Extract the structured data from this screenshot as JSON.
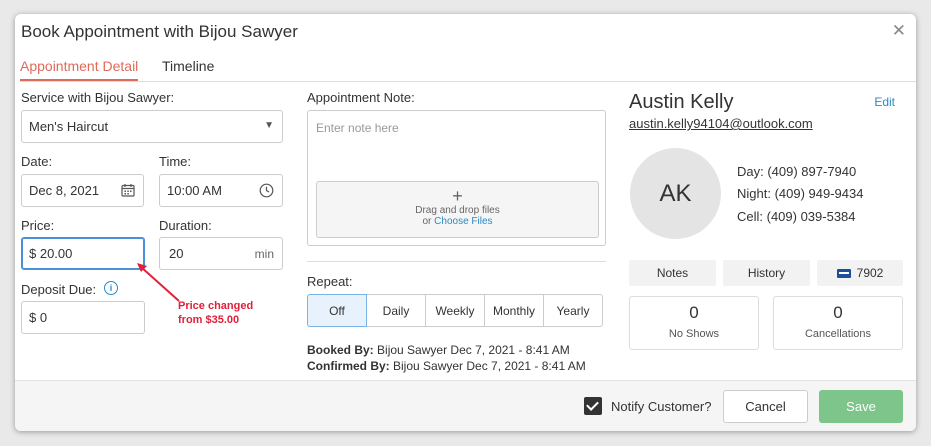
{
  "dialog": {
    "title": "Book Appointment with Bijou Sawyer",
    "tabs": [
      {
        "label": "Appointment Detail",
        "active": true
      },
      {
        "label": "Timeline",
        "active": false
      }
    ]
  },
  "form": {
    "service_label": "Service with Bijou Sawyer:",
    "service_value": "Men's Haircut",
    "date_label": "Date:",
    "date_value": "Dec 8, 2021",
    "time_label": "Time:",
    "time_value": "10:00 AM",
    "price_label": "Price:",
    "price_value": "$ 20.00",
    "duration_label": "Duration:",
    "duration_value": "20",
    "duration_unit": "min",
    "deposit_label": "Deposit Due:",
    "deposit_value": "$ 0",
    "note_label": "Appointment Note:",
    "note_placeholder": "Enter note here",
    "drop_text": "Drag and drop files",
    "drop_or": "or ",
    "drop_link": "Choose Files",
    "repeat_label": "Repeat:",
    "repeat_options": [
      "Off",
      "Daily",
      "Weekly",
      "Monthly",
      "Yearly"
    ],
    "repeat_selected": "Off",
    "booked_by_label": "Booked By:",
    "booked_by_value": "Bijou Sawyer Dec 7, 2021 - 8:41 AM",
    "confirmed_by_label": "Confirmed By:",
    "confirmed_by_value": "Bijou Sawyer Dec 7, 2021 - 8:41 AM"
  },
  "annotation": {
    "line1": "Price changed",
    "line2": "from $35.00",
    "color": "#e0213a"
  },
  "customer": {
    "name": "Austin Kelly",
    "email": "austin.kelly94104@outlook.com",
    "edit_label": "Edit",
    "initials": "AK",
    "phones": [
      "Day: (409) 897-7940",
      "Night: (409) 949-9434",
      "Cell: (409) 039-5384"
    ],
    "tabs": {
      "notes": "Notes",
      "history": "History",
      "card_last4": "7902"
    },
    "stats": [
      {
        "value": "0",
        "label": "No Shows"
      },
      {
        "value": "0",
        "label": "Cancellations"
      }
    ]
  },
  "footer": {
    "notify_label": "Notify Customer?",
    "notify_checked": true,
    "cancel_label": "Cancel",
    "save_label": "Save"
  },
  "colors": {
    "accent": "#e06a5a",
    "link": "#2a8ac7",
    "save": "#7dc58a"
  }
}
